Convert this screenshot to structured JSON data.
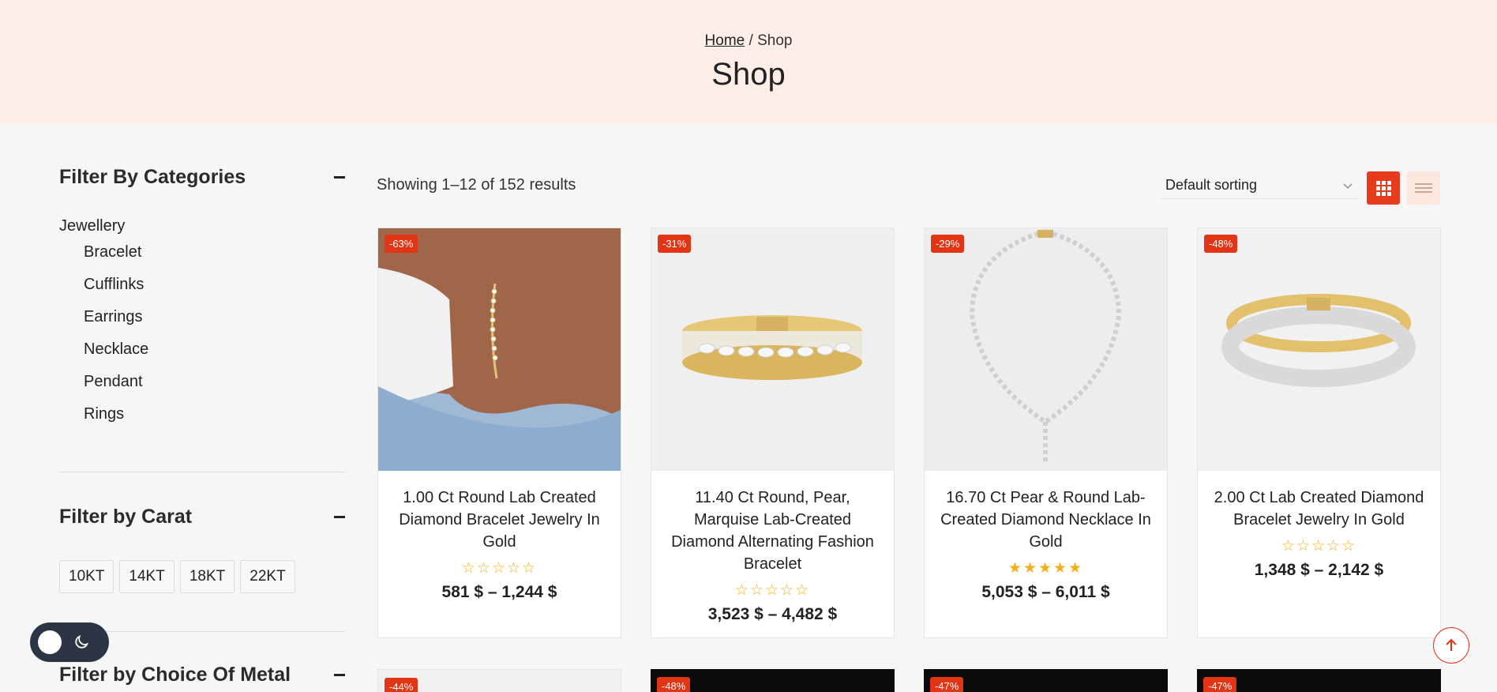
{
  "breadcrumb": {
    "home": "Home",
    "separator": "/",
    "current": "Shop"
  },
  "page_title": "Shop",
  "sidebar": {
    "categories_heading": "Filter By Categories",
    "root_category": "Jewellery",
    "categories": [
      "Bracelet",
      "Cufflinks",
      "Earrings",
      "Necklace",
      "Pendant",
      "Rings"
    ],
    "carat_heading": "Filter by Carat",
    "carats": [
      "10KT",
      "14KT",
      "18KT",
      "22KT"
    ],
    "metal_heading": "Filter by Choice Of Metal"
  },
  "toolbar": {
    "results_text": "Showing 1–12 of 152 results",
    "sort_selected": "Default sorting"
  },
  "products": [
    {
      "badge": "-63%",
      "title": "1.00 Ct Round Lab Created Diamond Bracelet Jewelry In Gold",
      "rating": 0,
      "stars": "☆☆☆☆☆",
      "price": "581 $ – 1,244 $"
    },
    {
      "badge": "-31%",
      "title": "11.40 Ct Round, Pear, Marquise Lab-Created Diamond Alternating Fashion Bracelet",
      "rating": 0,
      "stars": "☆☆☆☆☆",
      "price": "3,523 $ – 4,482 $"
    },
    {
      "badge": "-29%",
      "title": "16.70 Ct Pear & Round Lab-Created Diamond Necklace In Gold",
      "rating": 5,
      "stars": "★★★★★",
      "price": "5,053 $ – 6,011 $"
    },
    {
      "badge": "-48%",
      "title": "2.00 Ct Lab Created Diamond Bracelet Jewelry In Gold",
      "rating": 0,
      "stars": "☆☆☆☆☆",
      "price": "1,348 $ – 2,142 $"
    }
  ],
  "next_row_badges": [
    "-44%",
    "-48%",
    "-47%",
    "-47%"
  ],
  "colors": {
    "accent": "#e23516",
    "hero_bg": "#fdefe7",
    "star": "#f2b01e"
  }
}
